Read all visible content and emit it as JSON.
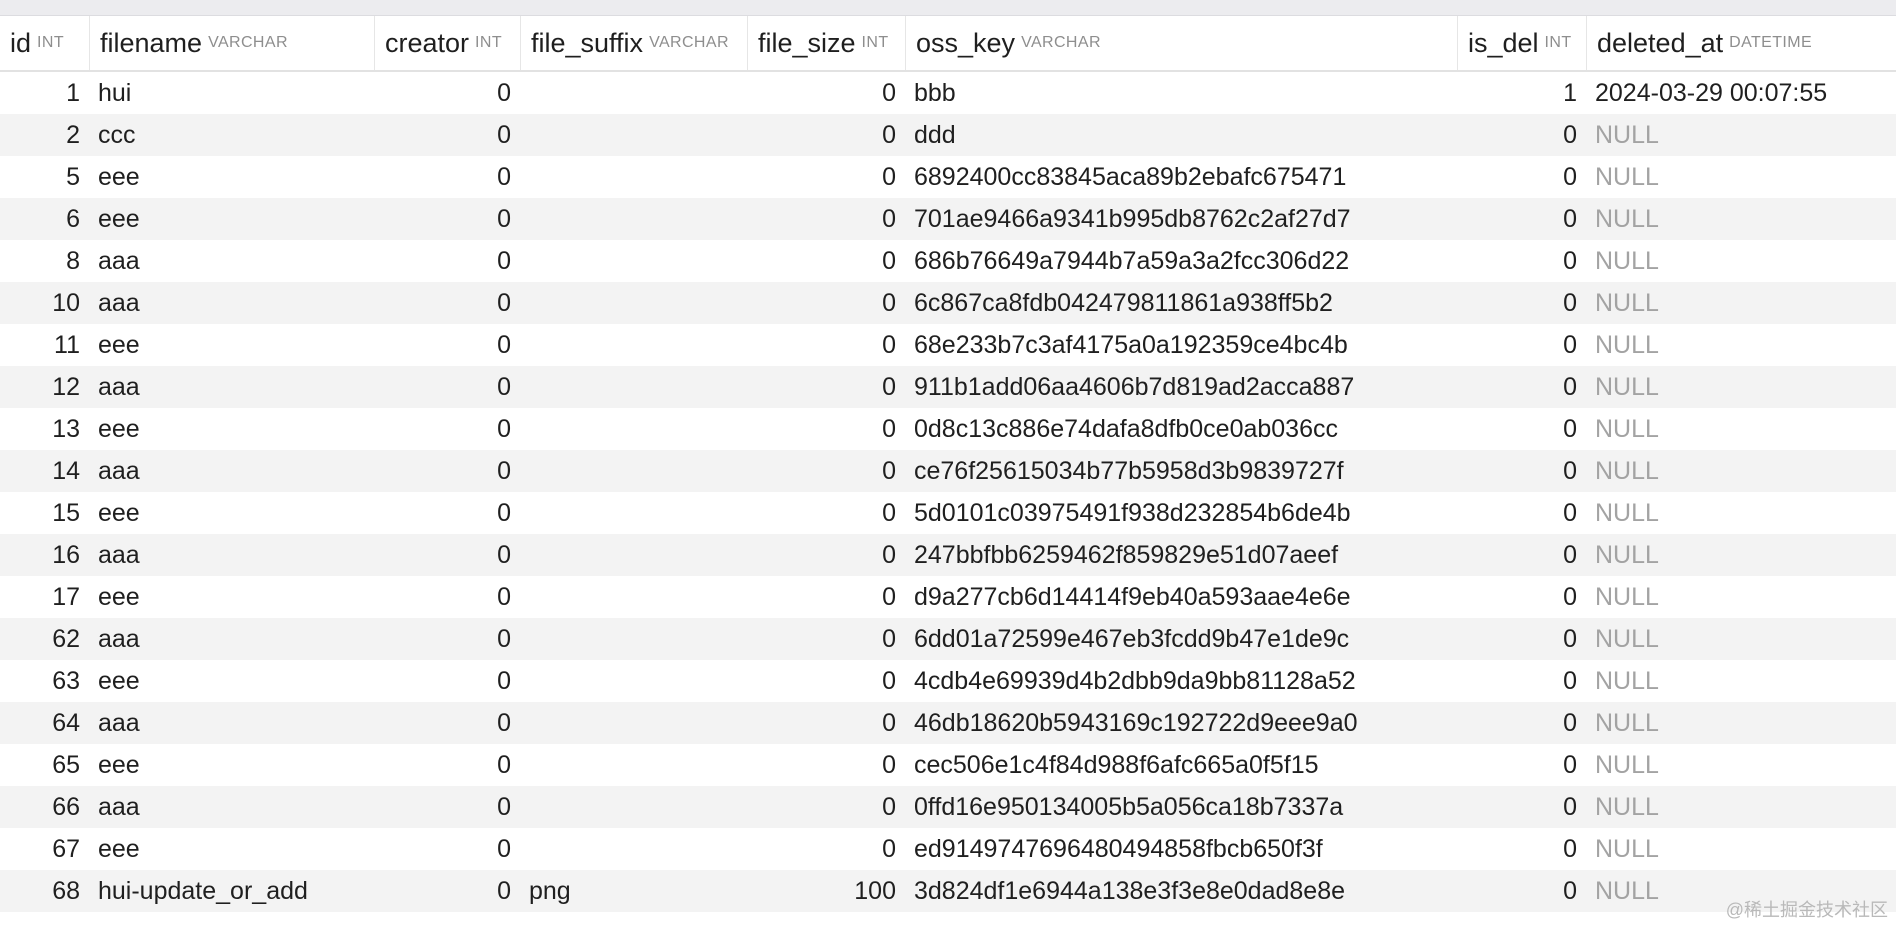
{
  "columns": [
    {
      "name": "id",
      "type": "INT"
    },
    {
      "name": "filename",
      "type": "VARCHAR"
    },
    {
      "name": "creator",
      "type": "INT"
    },
    {
      "name": "file_suffix",
      "type": "VARCHAR"
    },
    {
      "name": "file_size",
      "type": "INT"
    },
    {
      "name": "oss_key",
      "type": "VARCHAR"
    },
    {
      "name": "is_del",
      "type": "INT"
    },
    {
      "name": "deleted_at",
      "type": "DATETIME"
    }
  ],
  "rows": [
    {
      "id": "1",
      "filename": "hui",
      "creator": "0",
      "file_suffix": "",
      "file_size": "0",
      "oss_key": "bbb",
      "is_del": "1",
      "deleted_at": "2024-03-29 00:07:55"
    },
    {
      "id": "2",
      "filename": "ccc",
      "creator": "0",
      "file_suffix": "",
      "file_size": "0",
      "oss_key": "ddd",
      "is_del": "0",
      "deleted_at": "NULL"
    },
    {
      "id": "5",
      "filename": "eee",
      "creator": "0",
      "file_suffix": "",
      "file_size": "0",
      "oss_key": "6892400cc83845aca89b2ebafc675471",
      "is_del": "0",
      "deleted_at": "NULL"
    },
    {
      "id": "6",
      "filename": "eee",
      "creator": "0",
      "file_suffix": "",
      "file_size": "0",
      "oss_key": "701ae9466a9341b995db8762c2af27d7",
      "is_del": "0",
      "deleted_at": "NULL"
    },
    {
      "id": "8",
      "filename": "aaa",
      "creator": "0",
      "file_suffix": "",
      "file_size": "0",
      "oss_key": "686b76649a7944b7a59a3a2fcc306d22",
      "is_del": "0",
      "deleted_at": "NULL"
    },
    {
      "id": "10",
      "filename": "aaa",
      "creator": "0",
      "file_suffix": "",
      "file_size": "0",
      "oss_key": "6c867ca8fdb042479811861a938ff5b2",
      "is_del": "0",
      "deleted_at": "NULL"
    },
    {
      "id": "11",
      "filename": "eee",
      "creator": "0",
      "file_suffix": "",
      "file_size": "0",
      "oss_key": "68e233b7c3af4175a0a192359ce4bc4b",
      "is_del": "0",
      "deleted_at": "NULL"
    },
    {
      "id": "12",
      "filename": "aaa",
      "creator": "0",
      "file_suffix": "",
      "file_size": "0",
      "oss_key": "911b1add06aa4606b7d819ad2acca887",
      "is_del": "0",
      "deleted_at": "NULL"
    },
    {
      "id": "13",
      "filename": "eee",
      "creator": "0",
      "file_suffix": "",
      "file_size": "0",
      "oss_key": "0d8c13c886e74dafa8dfb0ce0ab036cc",
      "is_del": "0",
      "deleted_at": "NULL"
    },
    {
      "id": "14",
      "filename": "aaa",
      "creator": "0",
      "file_suffix": "",
      "file_size": "0",
      "oss_key": "ce76f25615034b77b5958d3b9839727f",
      "is_del": "0",
      "deleted_at": "NULL"
    },
    {
      "id": "15",
      "filename": "eee",
      "creator": "0",
      "file_suffix": "",
      "file_size": "0",
      "oss_key": "5d0101c03975491f938d232854b6de4b",
      "is_del": "0",
      "deleted_at": "NULL"
    },
    {
      "id": "16",
      "filename": "aaa",
      "creator": "0",
      "file_suffix": "",
      "file_size": "0",
      "oss_key": "247bbfbb6259462f859829e51d07aeef",
      "is_del": "0",
      "deleted_at": "NULL"
    },
    {
      "id": "17",
      "filename": "eee",
      "creator": "0",
      "file_suffix": "",
      "file_size": "0",
      "oss_key": "d9a277cb6d14414f9eb40a593aae4e6e",
      "is_del": "0",
      "deleted_at": "NULL"
    },
    {
      "id": "62",
      "filename": "aaa",
      "creator": "0",
      "file_suffix": "",
      "file_size": "0",
      "oss_key": "6dd01a72599e467eb3fcdd9b47e1de9c",
      "is_del": "0",
      "deleted_at": "NULL"
    },
    {
      "id": "63",
      "filename": "eee",
      "creator": "0",
      "file_suffix": "",
      "file_size": "0",
      "oss_key": "4cdb4e69939d4b2dbb9da9bb81128a52",
      "is_del": "0",
      "deleted_at": "NULL"
    },
    {
      "id": "64",
      "filename": "aaa",
      "creator": "0",
      "file_suffix": "",
      "file_size": "0",
      "oss_key": "46db18620b5943169c192722d9eee9a0",
      "is_del": "0",
      "deleted_at": "NULL"
    },
    {
      "id": "65",
      "filename": "eee",
      "creator": "0",
      "file_suffix": "",
      "file_size": "0",
      "oss_key": "cec506e1c4f84d988f6afc665a0f5f15",
      "is_del": "0",
      "deleted_at": "NULL"
    },
    {
      "id": "66",
      "filename": "aaa",
      "creator": "0",
      "file_suffix": "",
      "file_size": "0",
      "oss_key": "0ffd16e950134005b5a056ca18b7337a",
      "is_del": "0",
      "deleted_at": "NULL"
    },
    {
      "id": "67",
      "filename": "eee",
      "creator": "0",
      "file_suffix": "",
      "file_size": "0",
      "oss_key": "ed9149747696480494858fbcb650f3f",
      "is_del": "0",
      "deleted_at": "NULL"
    },
    {
      "id": "68",
      "filename": "hui-update_or_add",
      "creator": "0",
      "file_suffix": "png",
      "file_size": "100",
      "oss_key": "3d824df1e6944a138e3f3e8e0dad8e8e",
      "is_del": "0",
      "deleted_at": "NULL"
    }
  ],
  "watermark": "@稀土掘金技术社区"
}
